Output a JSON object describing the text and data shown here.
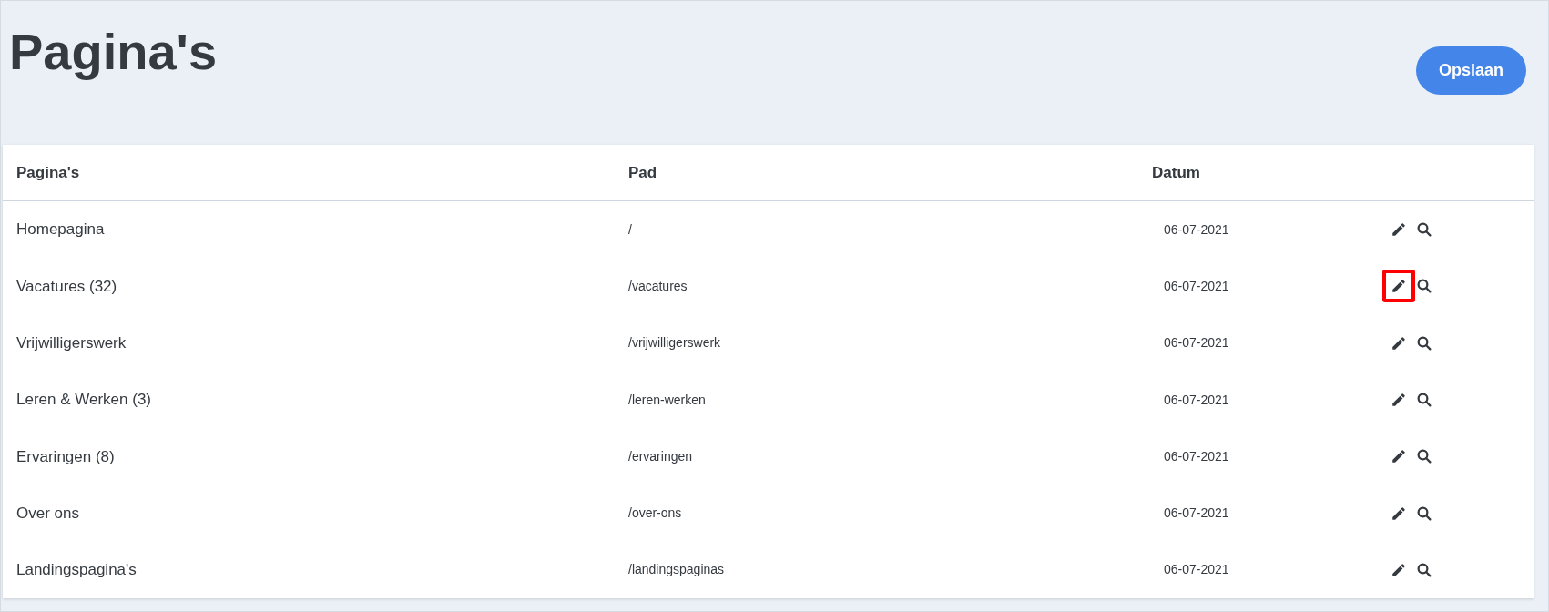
{
  "page_title": "Pagina's",
  "save_button": "Opslaan",
  "table": {
    "columns": [
      "Pagina's",
      "Pad",
      "Datum"
    ],
    "rows": [
      {
        "name": "Homepagina",
        "path": "/",
        "date": "06-07-2021",
        "highlighted": false
      },
      {
        "name": "Vacatures (32)",
        "path": "/vacatures",
        "date": "06-07-2021",
        "highlighted": true
      },
      {
        "name": "Vrijwilligerswerk",
        "path": "/vrijwilligerswerk",
        "date": "06-07-2021",
        "highlighted": false
      },
      {
        "name": "Leren & Werken (3)",
        "path": "/leren-werken",
        "date": "06-07-2021",
        "highlighted": false
      },
      {
        "name": "Ervaringen (8)",
        "path": "/ervaringen",
        "date": "06-07-2021",
        "highlighted": false
      },
      {
        "name": "Over ons",
        "path": "/over-ons",
        "date": "06-07-2021",
        "highlighted": false
      },
      {
        "name": "Landingspagina's",
        "path": "/landingspaginas",
        "date": "06-07-2021",
        "highlighted": false
      }
    ]
  }
}
